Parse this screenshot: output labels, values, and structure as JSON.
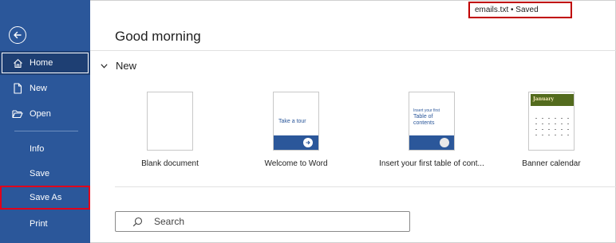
{
  "header": {
    "greeting": "Good morning",
    "file_status": "emails.txt • Saved"
  },
  "sidebar": {
    "back_icon": "back-arrow-icon",
    "items": [
      {
        "label": "Home",
        "icon": "home-icon",
        "state": "active"
      },
      {
        "label": "New",
        "icon": "new-document-icon"
      },
      {
        "label": "Open",
        "icon": "open-folder-icon"
      },
      {
        "label": "Info"
      },
      {
        "label": "Save"
      },
      {
        "label": "Save As",
        "state": "highlighted"
      },
      {
        "label": "Print"
      }
    ]
  },
  "new_section": {
    "title": "New",
    "templates": [
      {
        "name": "Blank document"
      },
      {
        "name": "Welcome to Word",
        "thumb_text": "Take a tour"
      },
      {
        "name": "Insert your first table of cont...",
        "thumb_text_small": "Insert your first",
        "thumb_text_large": "Table of contents"
      },
      {
        "name": "Banner calendar",
        "thumb_text": "January"
      }
    ]
  },
  "search": {
    "placeholder": "Search"
  },
  "colors": {
    "sidebar_bg": "#2b579a",
    "highlight_border": "#c00000"
  }
}
